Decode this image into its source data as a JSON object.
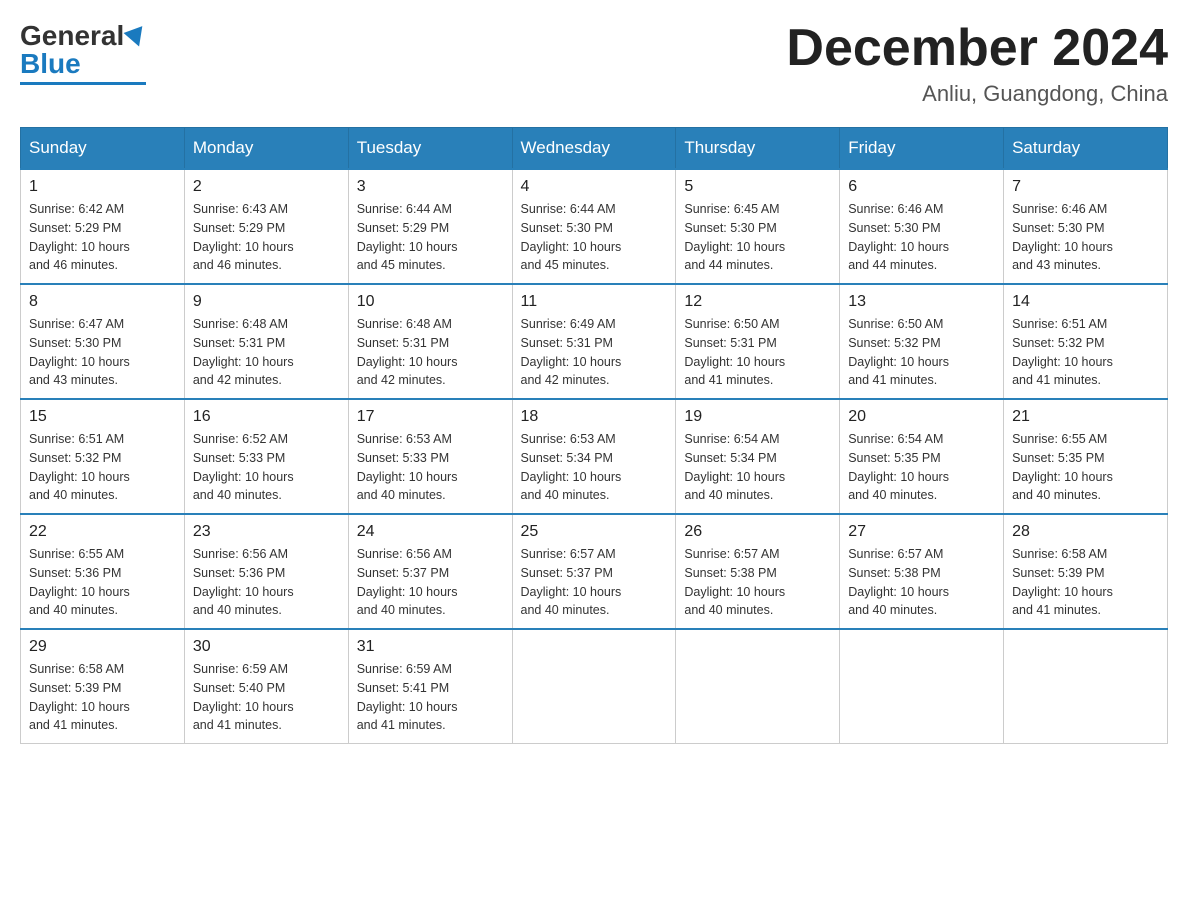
{
  "logo": {
    "general": "General",
    "blue": "Blue"
  },
  "title": {
    "month_year": "December 2024",
    "location": "Anliu, Guangdong, China"
  },
  "days_of_week": [
    "Sunday",
    "Monday",
    "Tuesday",
    "Wednesday",
    "Thursday",
    "Friday",
    "Saturday"
  ],
  "weeks": [
    [
      {
        "day": "1",
        "sunrise": "6:42 AM",
        "sunset": "5:29 PM",
        "daylight": "10 hours and 46 minutes."
      },
      {
        "day": "2",
        "sunrise": "6:43 AM",
        "sunset": "5:29 PM",
        "daylight": "10 hours and 46 minutes."
      },
      {
        "day": "3",
        "sunrise": "6:44 AM",
        "sunset": "5:29 PM",
        "daylight": "10 hours and 45 minutes."
      },
      {
        "day": "4",
        "sunrise": "6:44 AM",
        "sunset": "5:30 PM",
        "daylight": "10 hours and 45 minutes."
      },
      {
        "day": "5",
        "sunrise": "6:45 AM",
        "sunset": "5:30 PM",
        "daylight": "10 hours and 44 minutes."
      },
      {
        "day": "6",
        "sunrise": "6:46 AM",
        "sunset": "5:30 PM",
        "daylight": "10 hours and 44 minutes."
      },
      {
        "day": "7",
        "sunrise": "6:46 AM",
        "sunset": "5:30 PM",
        "daylight": "10 hours and 43 minutes."
      }
    ],
    [
      {
        "day": "8",
        "sunrise": "6:47 AM",
        "sunset": "5:30 PM",
        "daylight": "10 hours and 43 minutes."
      },
      {
        "day": "9",
        "sunrise": "6:48 AM",
        "sunset": "5:31 PM",
        "daylight": "10 hours and 42 minutes."
      },
      {
        "day": "10",
        "sunrise": "6:48 AM",
        "sunset": "5:31 PM",
        "daylight": "10 hours and 42 minutes."
      },
      {
        "day": "11",
        "sunrise": "6:49 AM",
        "sunset": "5:31 PM",
        "daylight": "10 hours and 42 minutes."
      },
      {
        "day": "12",
        "sunrise": "6:50 AM",
        "sunset": "5:31 PM",
        "daylight": "10 hours and 41 minutes."
      },
      {
        "day": "13",
        "sunrise": "6:50 AM",
        "sunset": "5:32 PM",
        "daylight": "10 hours and 41 minutes."
      },
      {
        "day": "14",
        "sunrise": "6:51 AM",
        "sunset": "5:32 PM",
        "daylight": "10 hours and 41 minutes."
      }
    ],
    [
      {
        "day": "15",
        "sunrise": "6:51 AM",
        "sunset": "5:32 PM",
        "daylight": "10 hours and 40 minutes."
      },
      {
        "day": "16",
        "sunrise": "6:52 AM",
        "sunset": "5:33 PM",
        "daylight": "10 hours and 40 minutes."
      },
      {
        "day": "17",
        "sunrise": "6:53 AM",
        "sunset": "5:33 PM",
        "daylight": "10 hours and 40 minutes."
      },
      {
        "day": "18",
        "sunrise": "6:53 AM",
        "sunset": "5:34 PM",
        "daylight": "10 hours and 40 minutes."
      },
      {
        "day": "19",
        "sunrise": "6:54 AM",
        "sunset": "5:34 PM",
        "daylight": "10 hours and 40 minutes."
      },
      {
        "day": "20",
        "sunrise": "6:54 AM",
        "sunset": "5:35 PM",
        "daylight": "10 hours and 40 minutes."
      },
      {
        "day": "21",
        "sunrise": "6:55 AM",
        "sunset": "5:35 PM",
        "daylight": "10 hours and 40 minutes."
      }
    ],
    [
      {
        "day": "22",
        "sunrise": "6:55 AM",
        "sunset": "5:36 PM",
        "daylight": "10 hours and 40 minutes."
      },
      {
        "day": "23",
        "sunrise": "6:56 AM",
        "sunset": "5:36 PM",
        "daylight": "10 hours and 40 minutes."
      },
      {
        "day": "24",
        "sunrise": "6:56 AM",
        "sunset": "5:37 PM",
        "daylight": "10 hours and 40 minutes."
      },
      {
        "day": "25",
        "sunrise": "6:57 AM",
        "sunset": "5:37 PM",
        "daylight": "10 hours and 40 minutes."
      },
      {
        "day": "26",
        "sunrise": "6:57 AM",
        "sunset": "5:38 PM",
        "daylight": "10 hours and 40 minutes."
      },
      {
        "day": "27",
        "sunrise": "6:57 AM",
        "sunset": "5:38 PM",
        "daylight": "10 hours and 40 minutes."
      },
      {
        "day": "28",
        "sunrise": "6:58 AM",
        "sunset": "5:39 PM",
        "daylight": "10 hours and 41 minutes."
      }
    ],
    [
      {
        "day": "29",
        "sunrise": "6:58 AM",
        "sunset": "5:39 PM",
        "daylight": "10 hours and 41 minutes."
      },
      {
        "day": "30",
        "sunrise": "6:59 AM",
        "sunset": "5:40 PM",
        "daylight": "10 hours and 41 minutes."
      },
      {
        "day": "31",
        "sunrise": "6:59 AM",
        "sunset": "5:41 PM",
        "daylight": "10 hours and 41 minutes."
      },
      null,
      null,
      null,
      null
    ]
  ],
  "labels": {
    "sunrise": "Sunrise:",
    "sunset": "Sunset:",
    "daylight": "Daylight:"
  }
}
